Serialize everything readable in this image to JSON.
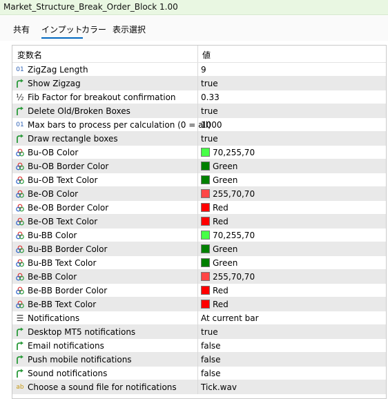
{
  "window": {
    "title": "Market_Structure_Break_Order_Block 1.00"
  },
  "tabs": [
    {
      "label": "共有"
    },
    {
      "label": "インプット"
    },
    {
      "label": "カラー"
    },
    {
      "label": "表示選択"
    }
  ],
  "grid": {
    "col_name": "変数名",
    "col_value": "値",
    "rows": [
      {
        "icon": "int-icon",
        "name": "ZigZag Length",
        "value": "9"
      },
      {
        "icon": "bool-icon",
        "name": "Show Zigzag",
        "value": "true"
      },
      {
        "icon": "double-icon",
        "name": "Fib Factor for breakout confirmation",
        "value": "0.33"
      },
      {
        "icon": "bool-icon",
        "name": "Delete Old/Broken Boxes",
        "value": "true"
      },
      {
        "icon": "int-icon",
        "name": "Max bars to process per calculation (0 = all)",
        "value": "1000"
      },
      {
        "icon": "bool-icon",
        "name": "Draw rectangle boxes",
        "value": "true"
      },
      {
        "icon": "color-icon",
        "name": "Bu-OB Color",
        "value": "70,255,70",
        "swatch": "#46ff46"
      },
      {
        "icon": "color-icon",
        "name": "Bu-OB Border Color",
        "value": "Green",
        "swatch": "#008000"
      },
      {
        "icon": "color-icon",
        "name": "Bu-OB Text Color",
        "value": "Green",
        "swatch": "#008000"
      },
      {
        "icon": "color-icon",
        "name": "Be-OB Color",
        "value": "255,70,70",
        "swatch": "#ff4646"
      },
      {
        "icon": "color-icon",
        "name": "Be-OB Border Color",
        "value": "Red",
        "swatch": "#ff0000"
      },
      {
        "icon": "color-icon",
        "name": "Be-OB Text Color",
        "value": "Red",
        "swatch": "#ff0000"
      },
      {
        "icon": "color-icon",
        "name": "Bu-BB Color",
        "value": "70,255,70",
        "swatch": "#46ff46"
      },
      {
        "icon": "color-icon",
        "name": "Bu-BB Border Color",
        "value": "Green",
        "swatch": "#008000"
      },
      {
        "icon": "color-icon",
        "name": "Bu-BB Text Color",
        "value": "Green",
        "swatch": "#008000"
      },
      {
        "icon": "color-icon",
        "name": "Be-BB Color",
        "value": "255,70,70",
        "swatch": "#ff4646"
      },
      {
        "icon": "color-icon",
        "name": "Be-BB Border Color",
        "value": "Red",
        "swatch": "#ff0000"
      },
      {
        "icon": "color-icon",
        "name": "Be-BB Text Color",
        "value": "Red",
        "swatch": "#ff0000"
      },
      {
        "icon": "enum-icon",
        "name": "Notifications",
        "value": "At current bar"
      },
      {
        "icon": "bool-icon",
        "name": "Desktop MT5 notifications",
        "value": "true"
      },
      {
        "icon": "bool-icon",
        "name": "Email notifications",
        "value": "false"
      },
      {
        "icon": "bool-icon",
        "name": "Push mobile notifications",
        "value": "false"
      },
      {
        "icon": "bool-icon",
        "name": "Sound notifications",
        "value": "false"
      },
      {
        "icon": "string-icon",
        "name": "Choose a sound file for notifications",
        "value": "Tick.wav"
      }
    ]
  },
  "icon_glyphs": {
    "int-icon": "01",
    "double-icon": "½",
    "enum-icon": "☰",
    "string-icon": "ab"
  }
}
